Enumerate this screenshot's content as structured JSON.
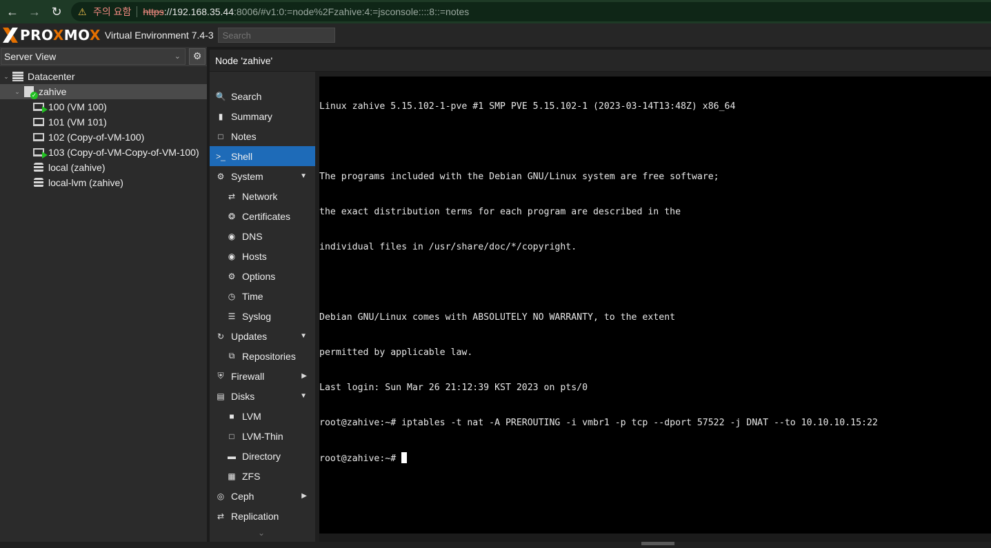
{
  "browser": {
    "warning": "주의 요함",
    "url_https": "https",
    "url_host": "://192.168.35.44",
    "url_path": ":8006/#v1:0:=node%2Fzahive:4:=jsconsole::::8::=notes"
  },
  "header": {
    "logo_prefix": "PRO",
    "logo_x": "X",
    "logo_mid": "MO",
    "logo_x2": "X",
    "version": "Virtual Environment 7.4-3",
    "search_placeholder": "Search"
  },
  "tree": {
    "view": "Server View",
    "items": [
      {
        "label": "Datacenter"
      },
      {
        "label": "zahive"
      },
      {
        "label": "100 (VM 100)"
      },
      {
        "label": "101 (VM 101)"
      },
      {
        "label": "102 (Copy-of-VM-100)"
      },
      {
        "label": "103 (Copy-of-VM-Copy-of-VM-100)"
      },
      {
        "label": "local (zahive)"
      },
      {
        "label": "local-lvm (zahive)"
      }
    ]
  },
  "content": {
    "title_prefix": "Node ",
    "title_name": "'zahive'"
  },
  "menu": [
    {
      "label": "Search",
      "icon": "search-icon"
    },
    {
      "label": "Summary",
      "icon": "book-icon"
    },
    {
      "label": "Notes",
      "icon": "notes-icon"
    },
    {
      "label": "Shell",
      "icon": "terminal-icon"
    },
    {
      "label": "System",
      "icon": "cogs-icon"
    },
    {
      "label": "Network",
      "icon": "exchange-icon"
    },
    {
      "label": "Certificates",
      "icon": "certificate-icon"
    },
    {
      "label": "DNS",
      "icon": "globe-icon"
    },
    {
      "label": "Hosts",
      "icon": "globe-icon"
    },
    {
      "label": "Options",
      "icon": "gear-icon"
    },
    {
      "label": "Time",
      "icon": "clock-icon"
    },
    {
      "label": "Syslog",
      "icon": "list-icon"
    },
    {
      "label": "Updates",
      "icon": "refresh-icon"
    },
    {
      "label": "Repositories",
      "icon": "files-icon"
    },
    {
      "label": "Firewall",
      "icon": "shield-icon"
    },
    {
      "label": "Disks",
      "icon": "hdd-icon"
    },
    {
      "label": "LVM",
      "icon": "square-icon"
    },
    {
      "label": "LVM-Thin",
      "icon": "square-outline-icon"
    },
    {
      "label": "Directory",
      "icon": "folder-icon"
    },
    {
      "label": "ZFS",
      "icon": "grid-icon"
    },
    {
      "label": "Ceph",
      "icon": "ceph-icon"
    },
    {
      "label": "Replication",
      "icon": "retweet-icon"
    }
  ],
  "terminal": {
    "lines": [
      "Linux zahive 5.15.102-1-pve #1 SMP PVE 5.15.102-1 (2023-03-14T13:48Z) x86_64",
      "",
      "The programs included with the Debian GNU/Linux system are free software;",
      "the exact distribution terms for each program are described in the",
      "individual files in /usr/share/doc/*/copyright.",
      "",
      "Debian GNU/Linux comes with ABSOLUTELY NO WARRANTY, to the extent",
      "permitted by applicable law.",
      "Last login: Sun Mar 26 21:12:39 KST 2023 on pts/0",
      "root@zahive:~# iptables -t nat -A PREROUTING -i vmbr1 -p tcp --dport 57522 -j DNAT --to 10.10.10.15:22"
    ],
    "prompt": "root@zahive:~# "
  }
}
